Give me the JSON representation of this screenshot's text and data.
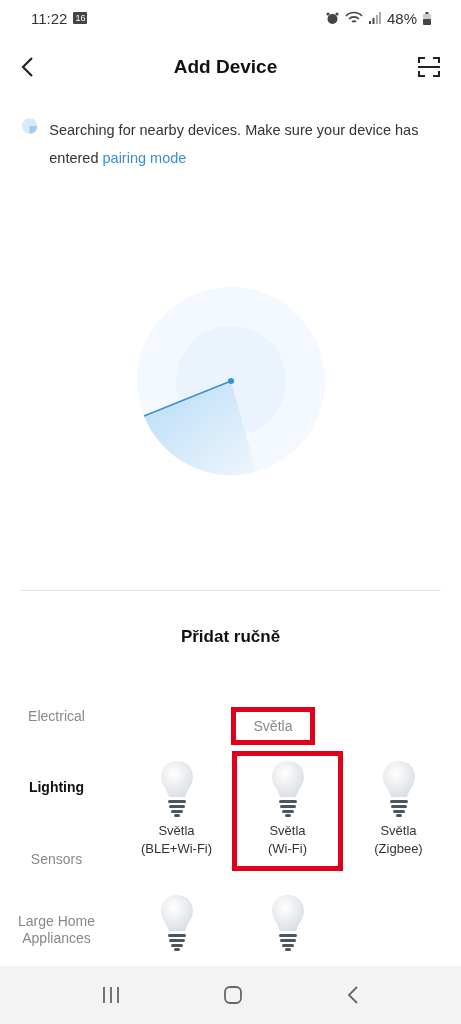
{
  "status_bar": {
    "time": "11:22",
    "calendar_day": "16",
    "battery": "48%"
  },
  "header": {
    "title": "Add Device"
  },
  "search": {
    "message": "Searching for nearby devices. Make sure your device has entered ",
    "link": "pairing mode"
  },
  "manual": {
    "title": "Přidat ručně"
  },
  "categories": [
    {
      "label": "Electrical",
      "selected": false
    },
    {
      "label": "Lighting",
      "selected": true
    },
    {
      "label": "Sensors",
      "selected": false
    },
    {
      "label": "Large Home Appliances",
      "selected": false
    }
  ],
  "section": {
    "title": "Světla",
    "highlighted": true
  },
  "devices": [
    {
      "label": "Světla\n(BLE+Wi-Fi)",
      "highlighted": false
    },
    {
      "label": "Světla\n(Wi-Fi)",
      "highlighted": true
    },
    {
      "label": "Světla\n(Zigbee)",
      "highlighted": false
    },
    {
      "highlighted": false
    },
    {
      "highlighted": false
    }
  ]
}
